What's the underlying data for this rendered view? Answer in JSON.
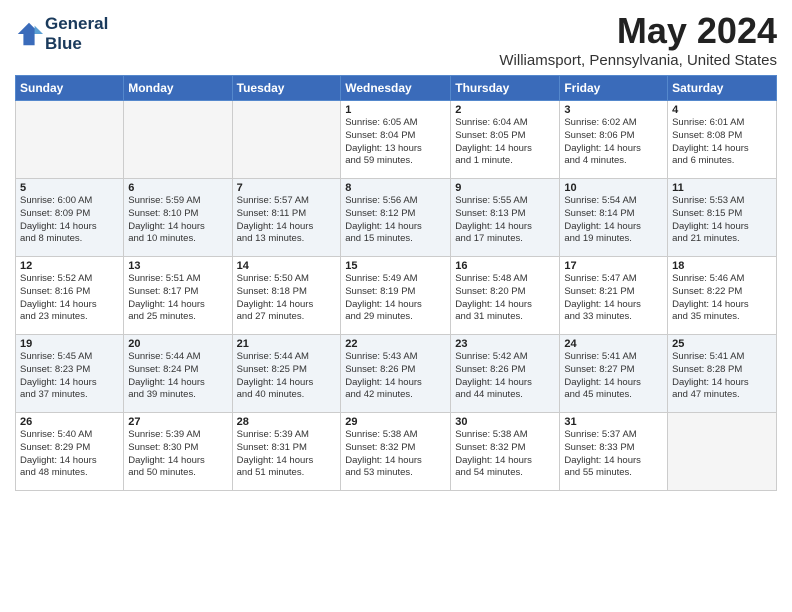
{
  "header": {
    "logo_line1": "General",
    "logo_line2": "Blue",
    "month_title": "May 2024",
    "location": "Williamsport, Pennsylvania, United States"
  },
  "days_of_week": [
    "Sunday",
    "Monday",
    "Tuesday",
    "Wednesday",
    "Thursday",
    "Friday",
    "Saturday"
  ],
  "weeks": [
    [
      {
        "day": "",
        "info": ""
      },
      {
        "day": "",
        "info": ""
      },
      {
        "day": "",
        "info": ""
      },
      {
        "day": "1",
        "info": "Sunrise: 6:05 AM\nSunset: 8:04 PM\nDaylight: 13 hours\nand 59 minutes."
      },
      {
        "day": "2",
        "info": "Sunrise: 6:04 AM\nSunset: 8:05 PM\nDaylight: 14 hours\nand 1 minute."
      },
      {
        "day": "3",
        "info": "Sunrise: 6:02 AM\nSunset: 8:06 PM\nDaylight: 14 hours\nand 4 minutes."
      },
      {
        "day": "4",
        "info": "Sunrise: 6:01 AM\nSunset: 8:08 PM\nDaylight: 14 hours\nand 6 minutes."
      }
    ],
    [
      {
        "day": "5",
        "info": "Sunrise: 6:00 AM\nSunset: 8:09 PM\nDaylight: 14 hours\nand 8 minutes."
      },
      {
        "day": "6",
        "info": "Sunrise: 5:59 AM\nSunset: 8:10 PM\nDaylight: 14 hours\nand 10 minutes."
      },
      {
        "day": "7",
        "info": "Sunrise: 5:57 AM\nSunset: 8:11 PM\nDaylight: 14 hours\nand 13 minutes."
      },
      {
        "day": "8",
        "info": "Sunrise: 5:56 AM\nSunset: 8:12 PM\nDaylight: 14 hours\nand 15 minutes."
      },
      {
        "day": "9",
        "info": "Sunrise: 5:55 AM\nSunset: 8:13 PM\nDaylight: 14 hours\nand 17 minutes."
      },
      {
        "day": "10",
        "info": "Sunrise: 5:54 AM\nSunset: 8:14 PM\nDaylight: 14 hours\nand 19 minutes."
      },
      {
        "day": "11",
        "info": "Sunrise: 5:53 AM\nSunset: 8:15 PM\nDaylight: 14 hours\nand 21 minutes."
      }
    ],
    [
      {
        "day": "12",
        "info": "Sunrise: 5:52 AM\nSunset: 8:16 PM\nDaylight: 14 hours\nand 23 minutes."
      },
      {
        "day": "13",
        "info": "Sunrise: 5:51 AM\nSunset: 8:17 PM\nDaylight: 14 hours\nand 25 minutes."
      },
      {
        "day": "14",
        "info": "Sunrise: 5:50 AM\nSunset: 8:18 PM\nDaylight: 14 hours\nand 27 minutes."
      },
      {
        "day": "15",
        "info": "Sunrise: 5:49 AM\nSunset: 8:19 PM\nDaylight: 14 hours\nand 29 minutes."
      },
      {
        "day": "16",
        "info": "Sunrise: 5:48 AM\nSunset: 8:20 PM\nDaylight: 14 hours\nand 31 minutes."
      },
      {
        "day": "17",
        "info": "Sunrise: 5:47 AM\nSunset: 8:21 PM\nDaylight: 14 hours\nand 33 minutes."
      },
      {
        "day": "18",
        "info": "Sunrise: 5:46 AM\nSunset: 8:22 PM\nDaylight: 14 hours\nand 35 minutes."
      }
    ],
    [
      {
        "day": "19",
        "info": "Sunrise: 5:45 AM\nSunset: 8:23 PM\nDaylight: 14 hours\nand 37 minutes."
      },
      {
        "day": "20",
        "info": "Sunrise: 5:44 AM\nSunset: 8:24 PM\nDaylight: 14 hours\nand 39 minutes."
      },
      {
        "day": "21",
        "info": "Sunrise: 5:44 AM\nSunset: 8:25 PM\nDaylight: 14 hours\nand 40 minutes."
      },
      {
        "day": "22",
        "info": "Sunrise: 5:43 AM\nSunset: 8:26 PM\nDaylight: 14 hours\nand 42 minutes."
      },
      {
        "day": "23",
        "info": "Sunrise: 5:42 AM\nSunset: 8:26 PM\nDaylight: 14 hours\nand 44 minutes."
      },
      {
        "day": "24",
        "info": "Sunrise: 5:41 AM\nSunset: 8:27 PM\nDaylight: 14 hours\nand 45 minutes."
      },
      {
        "day": "25",
        "info": "Sunrise: 5:41 AM\nSunset: 8:28 PM\nDaylight: 14 hours\nand 47 minutes."
      }
    ],
    [
      {
        "day": "26",
        "info": "Sunrise: 5:40 AM\nSunset: 8:29 PM\nDaylight: 14 hours\nand 48 minutes."
      },
      {
        "day": "27",
        "info": "Sunrise: 5:39 AM\nSunset: 8:30 PM\nDaylight: 14 hours\nand 50 minutes."
      },
      {
        "day": "28",
        "info": "Sunrise: 5:39 AM\nSunset: 8:31 PM\nDaylight: 14 hours\nand 51 minutes."
      },
      {
        "day": "29",
        "info": "Sunrise: 5:38 AM\nSunset: 8:32 PM\nDaylight: 14 hours\nand 53 minutes."
      },
      {
        "day": "30",
        "info": "Sunrise: 5:38 AM\nSunset: 8:32 PM\nDaylight: 14 hours\nand 54 minutes."
      },
      {
        "day": "31",
        "info": "Sunrise: 5:37 AM\nSunset: 8:33 PM\nDaylight: 14 hours\nand 55 minutes."
      },
      {
        "day": "",
        "info": ""
      }
    ]
  ]
}
